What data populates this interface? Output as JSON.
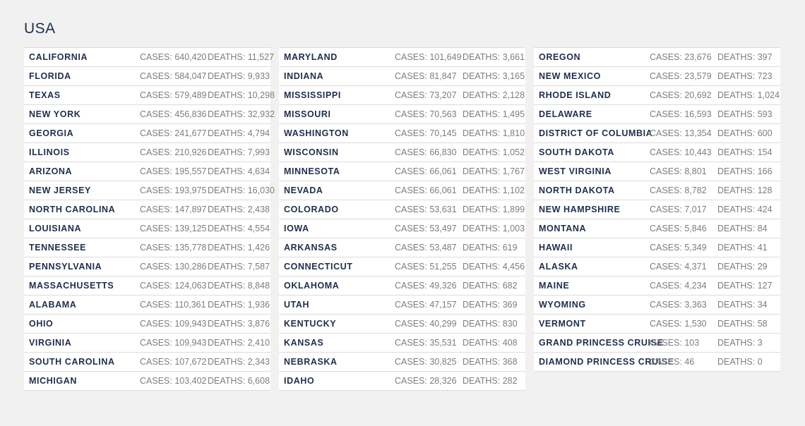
{
  "title": "USA",
  "labels": {
    "cases_prefix": "CASES: ",
    "deaths_prefix": "DEATHS: "
  },
  "colors": {
    "background": "#f1f1f1",
    "row_background": "#ffffff",
    "state_text": "#1d2f4d",
    "value_text": "#7d7d7d",
    "divider": "#dcdcdc"
  },
  "columns": [
    [
      {
        "state": "CALIFORNIA",
        "cases": "640,420",
        "deaths": "11,527"
      },
      {
        "state": "FLORIDA",
        "cases": "584,047",
        "deaths": "9,933"
      },
      {
        "state": "TEXAS",
        "cases": "579,489",
        "deaths": "10,298"
      },
      {
        "state": "NEW YORK",
        "cases": "456,836",
        "deaths": "32,932"
      },
      {
        "state": "GEORGIA",
        "cases": "241,677",
        "deaths": "4,794"
      },
      {
        "state": "ILLINOIS",
        "cases": "210,926",
        "deaths": "7,993"
      },
      {
        "state": "ARIZONA",
        "cases": "195,557",
        "deaths": "4,634"
      },
      {
        "state": "NEW JERSEY",
        "cases": "193,975",
        "deaths": "16,030"
      },
      {
        "state": "NORTH CAROLINA",
        "cases": "147,897",
        "deaths": "2,438"
      },
      {
        "state": "LOUISIANA",
        "cases": "139,125",
        "deaths": "4,554"
      },
      {
        "state": "TENNESSEE",
        "cases": "135,778",
        "deaths": "1,426"
      },
      {
        "state": "PENNSYLVANIA",
        "cases": "130,286",
        "deaths": "7,587"
      },
      {
        "state": "MASSACHUSETTS",
        "cases": "124,063",
        "deaths": "8,848"
      },
      {
        "state": "ALABAMA",
        "cases": "110,361",
        "deaths": "1,936"
      },
      {
        "state": "OHIO",
        "cases": "109,943",
        "deaths": "3,876"
      },
      {
        "state": "VIRGINIA",
        "cases": "109,943",
        "deaths": "2,410"
      },
      {
        "state": "SOUTH CAROLINA",
        "cases": "107,672",
        "deaths": "2,343"
      },
      {
        "state": "MICHIGAN",
        "cases": "103,402",
        "deaths": "6,608"
      }
    ],
    [
      {
        "state": "MARYLAND",
        "cases": "101,649",
        "deaths": "3,661"
      },
      {
        "state": "INDIANA",
        "cases": "81,847",
        "deaths": "3,165"
      },
      {
        "state": "MISSISSIPPI",
        "cases": "73,207",
        "deaths": "2,128"
      },
      {
        "state": "MISSOURI",
        "cases": "70,563",
        "deaths": "1,495"
      },
      {
        "state": "WASHINGTON",
        "cases": "70,145",
        "deaths": "1,810"
      },
      {
        "state": "WISCONSIN",
        "cases": "66,830",
        "deaths": "1,052"
      },
      {
        "state": "MINNESOTA",
        "cases": "66,061",
        "deaths": "1,767"
      },
      {
        "state": "NEVADA",
        "cases": "66,061",
        "deaths": "1,102"
      },
      {
        "state": "COLORADO",
        "cases": "53,631",
        "deaths": "1,899"
      },
      {
        "state": "IOWA",
        "cases": "53,497",
        "deaths": "1,003"
      },
      {
        "state": "ARKANSAS",
        "cases": "53,487",
        "deaths": "619"
      },
      {
        "state": "CONNECTICUT",
        "cases": "51,255",
        "deaths": "4,456"
      },
      {
        "state": "OKLAHOMA",
        "cases": "49,326",
        "deaths": "682"
      },
      {
        "state": "UTAH",
        "cases": "47,157",
        "deaths": "369"
      },
      {
        "state": "KENTUCKY",
        "cases": "40,299",
        "deaths": "830"
      },
      {
        "state": "KANSAS",
        "cases": "35,531",
        "deaths": "408"
      },
      {
        "state": "NEBRASKA",
        "cases": "30,825",
        "deaths": "368"
      },
      {
        "state": "IDAHO",
        "cases": "28,326",
        "deaths": "282"
      }
    ],
    [
      {
        "state": "OREGON",
        "cases": "23,676",
        "deaths": "397"
      },
      {
        "state": "NEW MEXICO",
        "cases": "23,579",
        "deaths": "723"
      },
      {
        "state": "RHODE ISLAND",
        "cases": "20,692",
        "deaths": "1,024"
      },
      {
        "state": "DELAWARE",
        "cases": "16,593",
        "deaths": "593"
      },
      {
        "state": "DISTRICT OF COLUMBIA",
        "cases": "13,354",
        "deaths": "600"
      },
      {
        "state": "SOUTH DAKOTA",
        "cases": "10,443",
        "deaths": "154"
      },
      {
        "state": "WEST VIRGINIA",
        "cases": "8,801",
        "deaths": "166"
      },
      {
        "state": "NORTH DAKOTA",
        "cases": "8,782",
        "deaths": "128"
      },
      {
        "state": "NEW HAMPSHIRE",
        "cases": "7,017",
        "deaths": "424"
      },
      {
        "state": "MONTANA",
        "cases": "5,846",
        "deaths": "84"
      },
      {
        "state": "HAWAII",
        "cases": "5,349",
        "deaths": "41"
      },
      {
        "state": "ALASKA",
        "cases": "4,371",
        "deaths": "29"
      },
      {
        "state": "MAINE",
        "cases": "4,234",
        "deaths": "127"
      },
      {
        "state": "WYOMING",
        "cases": "3,363",
        "deaths": "34"
      },
      {
        "state": "VERMONT",
        "cases": "1,530",
        "deaths": "58"
      },
      {
        "state": "GRAND PRINCESS CRUISE",
        "cases": "103",
        "deaths": "3"
      },
      {
        "state": "DIAMOND PRINCESS CRUISE",
        "cases": "46",
        "deaths": "0"
      }
    ]
  ]
}
